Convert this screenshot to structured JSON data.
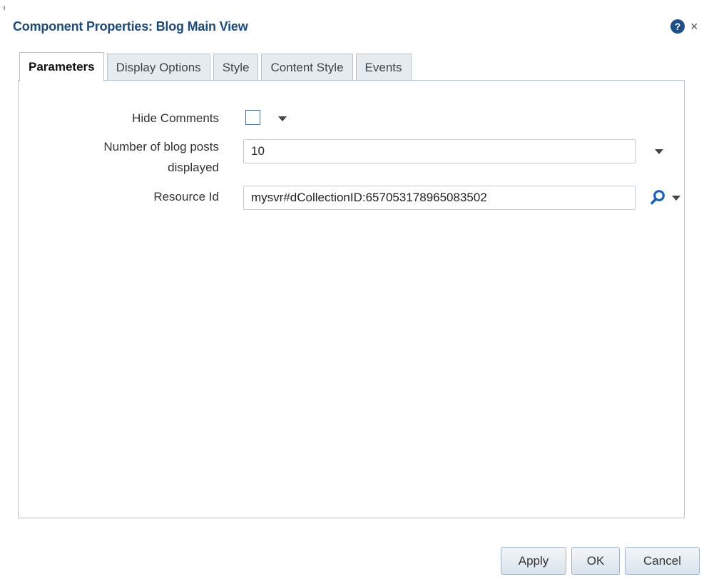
{
  "dialog": {
    "title": "Component Properties: Blog Main View",
    "help_icon": "question-icon",
    "help_glyph": "?",
    "close_icon": "close-icon",
    "close_glyph": "×"
  },
  "tabs": [
    {
      "label": "Parameters",
      "active": true
    },
    {
      "label": "Display Options",
      "active": false
    },
    {
      "label": "Style",
      "active": false
    },
    {
      "label": "Content Style",
      "active": false
    },
    {
      "label": "Events",
      "active": false
    }
  ],
  "fields": {
    "hide_comments": {
      "label": "Hide Comments",
      "checked": false
    },
    "num_posts": {
      "label_line1": "Number of blog posts",
      "label_line2": "displayed",
      "value": "10"
    },
    "resource_id": {
      "label": "Resource Id",
      "value": "mysvr#dCollectionID:657053178965083502",
      "search_icon": "search-icon"
    }
  },
  "buttons": {
    "apply": "Apply",
    "ok": "OK",
    "cancel": "Cancel"
  },
  "colors": {
    "title": "#1e4a78",
    "accent": "#1f4f86",
    "search_icon": "#1a62b8"
  }
}
